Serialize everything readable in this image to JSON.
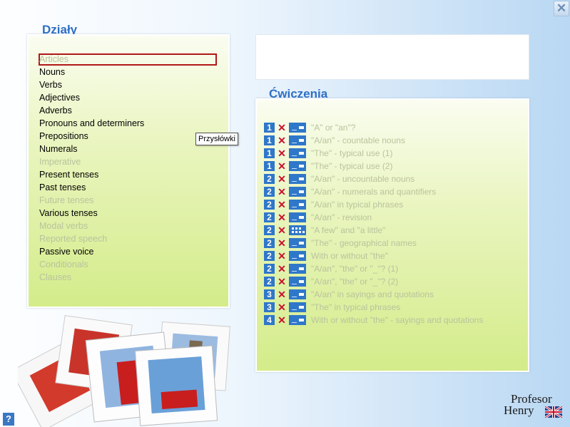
{
  "sections_title": "Działy",
  "exercises_title": "Ćwiczenia",
  "tooltip": "Przysłówki",
  "categories": [
    {
      "label": "Articles",
      "state": "disabled-selected"
    },
    {
      "label": "Nouns",
      "state": "active"
    },
    {
      "label": "Verbs",
      "state": "active"
    },
    {
      "label": "Adjectives",
      "state": "active"
    },
    {
      "label": "Adverbs",
      "state": "active"
    },
    {
      "label": "Pronouns and determiners",
      "state": "active"
    },
    {
      "label": "Prepositions",
      "state": "active"
    },
    {
      "label": "Numerals",
      "state": "active"
    },
    {
      "label": "Imperative",
      "state": "disabled"
    },
    {
      "label": "Present tenses",
      "state": "active"
    },
    {
      "label": "Past tenses",
      "state": "active"
    },
    {
      "label": "Future tenses",
      "state": "disabled"
    },
    {
      "label": "Various tenses",
      "state": "active"
    },
    {
      "label": "Modal verbs",
      "state": "disabled"
    },
    {
      "label": "Reported speech",
      "state": "disabled"
    },
    {
      "label": "Passive voice",
      "state": "active"
    },
    {
      "label": "Conditionals",
      "state": "disabled"
    },
    {
      "label": "Clauses",
      "state": "disabled"
    }
  ],
  "exercises": [
    {
      "level": "1",
      "title": "\"A\" or \"an\"?",
      "kind": "fill"
    },
    {
      "level": "1",
      "title": "\"A/an\" -  countable nouns",
      "kind": "fill"
    },
    {
      "level": "1",
      "title": "\"The\" - typical use (1)",
      "kind": "fill"
    },
    {
      "level": "1",
      "title": "\"The\" - typical use (2)",
      "kind": "fill"
    },
    {
      "level": "2",
      "title": "\"A/an\" - uncountable nouns",
      "kind": "fill"
    },
    {
      "level": "2",
      "title": "\"A/an\" - numerals and quantifiers",
      "kind": "fill"
    },
    {
      "level": "2",
      "title": "\"A/an\" in typical phrases",
      "kind": "fill"
    },
    {
      "level": "2",
      "title": "\"A/an\" - revision",
      "kind": "fill"
    },
    {
      "level": "2",
      "title": "\"A few\" and \"a little\"",
      "kind": "grid"
    },
    {
      "level": "2",
      "title": "\"The\" - geographical names",
      "kind": "fill"
    },
    {
      "level": "2",
      "title": "With or without \"the\"",
      "kind": "fill"
    },
    {
      "level": "2",
      "title": "\"A/an\", \"the\" or  \"_\"? (1)",
      "kind": "fill"
    },
    {
      "level": "2",
      "title": "\"A/an\", \"the\" or \"_\"? (2)",
      "kind": "fill"
    },
    {
      "level": "3",
      "title": "\"A/an\" in sayings and quotations",
      "kind": "fill"
    },
    {
      "level": "3",
      "title": "\"The\" in typical phrases",
      "kind": "fill"
    },
    {
      "level": "4",
      "title": "With or without \"the\" - sayings and quotations",
      "kind": "fill"
    }
  ],
  "status_mark": "✕",
  "close_symbol": "✕",
  "help_symbol": "?",
  "logo": {
    "line1": "Profesor",
    "line2": "Henry"
  },
  "colors": {
    "accent": "#2f77c9",
    "title": "#2f6fc4",
    "status_mark": "#c8102e",
    "selection": "#b01818"
  }
}
